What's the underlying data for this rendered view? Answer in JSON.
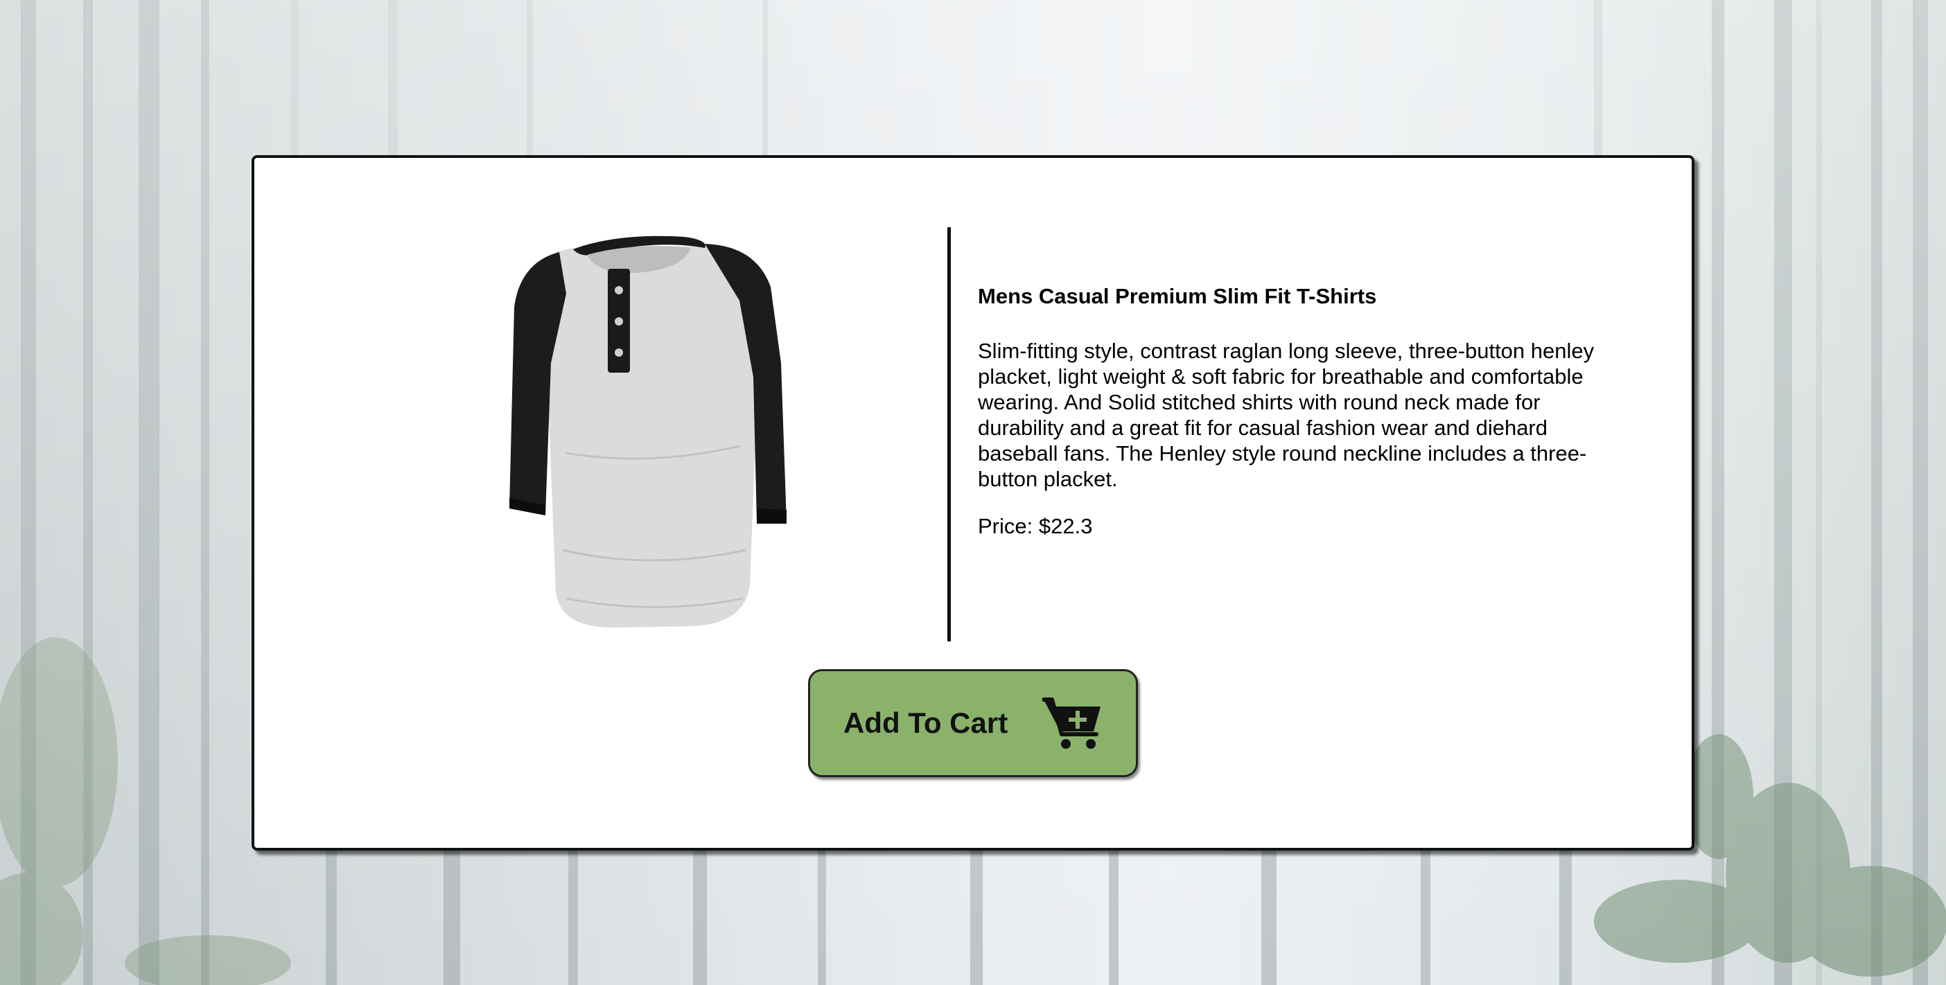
{
  "product": {
    "title": "Mens Casual Premium Slim Fit T-Shirts",
    "description": "Slim-fitting style, contrast raglan long sleeve, three-button henley placket, light weight & soft fabric for breathable and comfortable wearing. And Solid stitched shirts with round neck made for durability and a great fit for casual fashion wear and diehard baseball fans. The Henley style round neckline includes a three-button placket.",
    "price_text": "Price: $22.3",
    "image_icon": "henley-tshirt-image"
  },
  "cart": {
    "label": "Add To Cart",
    "icon": "cart-plus-icon"
  },
  "colors": {
    "button_bg": "#8ab26b",
    "card_bg": "#ffffff",
    "border": "#111111"
  }
}
